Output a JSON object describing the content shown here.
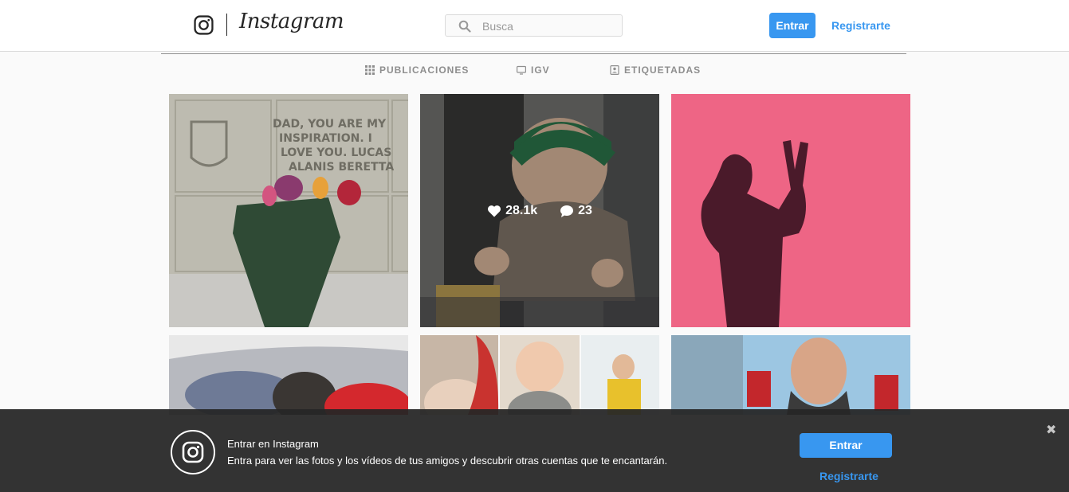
{
  "header": {
    "brand": "Instagram",
    "search_placeholder": "Busca",
    "login_label": "Entrar",
    "register_label": "Registrarte"
  },
  "tabs": [
    {
      "label": "PUBLICACIONES",
      "icon": "grid-icon"
    },
    {
      "label": "IGV",
      "icon": "tv-icon"
    },
    {
      "label": "ETIQUETADAS",
      "icon": "tag-person-icon"
    }
  ],
  "posts": [
    {
      "icon": "photo-flowers-memorial",
      "colors": [
        "#bdbbb0",
        "#2e4a33"
      ]
    },
    {
      "icon": "photo-baby-stroller",
      "colors": [
        "#7a7a78",
        "#2f7d4f"
      ],
      "likes": "28.1k",
      "comments": "23"
    },
    {
      "icon": "photo-shadow-pink-wall",
      "colors": [
        "#ee6585",
        "#4a1a2a"
      ]
    },
    {
      "icon": "photo-car-hug",
      "colors": [
        "#b7b9bf",
        "#3a3633"
      ]
    },
    {
      "icon": "photo-baby-collage",
      "colors": [
        "#e3d9cc",
        "#c9a23a"
      ]
    },
    {
      "icon": "photo-family-christmas",
      "colors": [
        "#9cc6e2",
        "#3b3b3b"
      ]
    }
  ],
  "banner": {
    "title": "Entrar en Instagram",
    "subtitle": "Entra para ver las fotos y los vídeos de tus amigos y descubrir otras cuentas que te encantarán.",
    "login_label": "Entrar",
    "register_label": "Registrarte",
    "close_glyph": "✖"
  },
  "colors": {
    "accent": "#3897f0",
    "banner_bg": "#262626",
    "pink_wall": "#ee6585"
  }
}
